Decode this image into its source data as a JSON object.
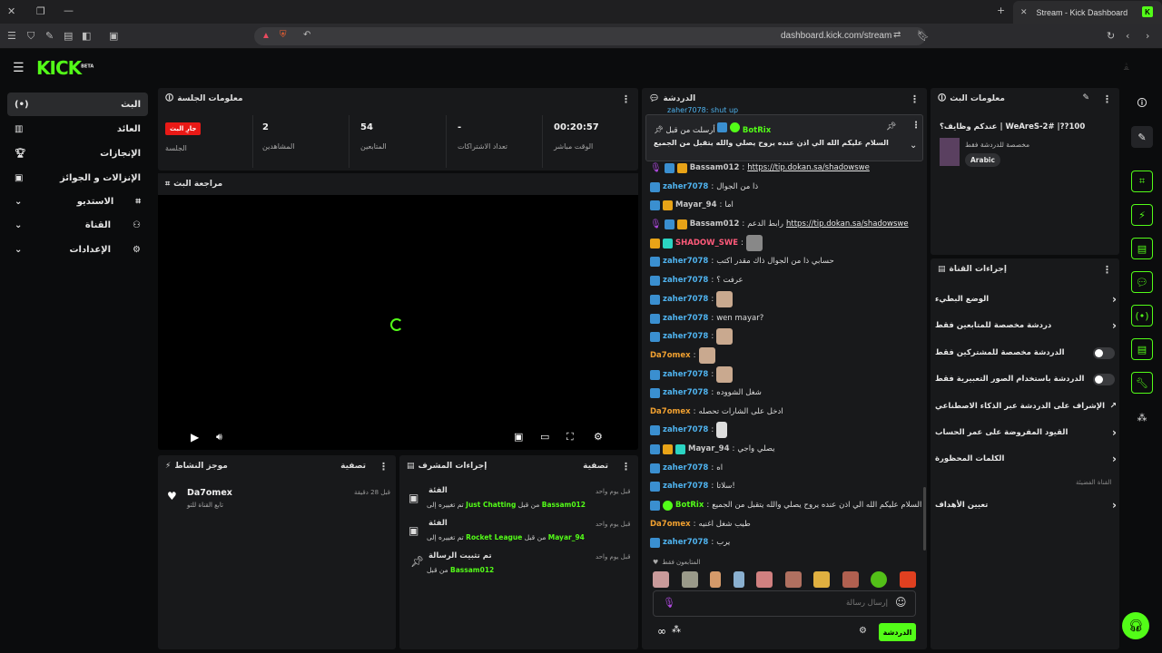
{
  "browser": {
    "tab_title": "Stream - Kick Dashboard",
    "url": "dashboard.kick.com/stream"
  },
  "brand": {
    "logo": "KICK",
    "beta": "BETA",
    "accent": "#53fc18"
  },
  "sidebar": {
    "items": [
      {
        "label": "البث",
        "icon": "broadcast-icon"
      },
      {
        "label": "العائد",
        "icon": "revenue-icon"
      },
      {
        "label": "الإنجازات",
        "icon": "trophy-icon"
      },
      {
        "label": "الإنزالات و الجوائز",
        "icon": "drops-icon"
      },
      {
        "label": "الاستديو",
        "icon": "studio-icon"
      },
      {
        "label": "القناة",
        "icon": "channel-icon"
      },
      {
        "label": "الإعدادات",
        "icon": "gear-icon"
      }
    ]
  },
  "session": {
    "title": "معلومات الجلسة",
    "badge": "جارِ البث",
    "badge_label": "الجلسة",
    "viewers_value": "2",
    "viewers_label": "المشاهدين",
    "followers_value": "54",
    "followers_label": "المتابعين",
    "subs_value": "-",
    "subs_label": "تعداد الاشتراكات",
    "time_value": "00:20:57",
    "time_label": "الوقت مباشر"
  },
  "preview": {
    "title": "مراجعة البث"
  },
  "activity": {
    "title": "موجز النشاط",
    "filter": "تصفية",
    "items": [
      {
        "user": "Da7omex",
        "text": "تابع القناة للتو",
        "time": "قبل 28 دقيقة"
      }
    ]
  },
  "mod_actions": {
    "title": "إجراءات المشرف",
    "filter": "تصفية",
    "items": [
      {
        "title": "الفئة",
        "pre": "تم تغييره إلى",
        "value": "Just Chatting",
        "by": "من قبل",
        "user": "Bassam012",
        "time": "قبل يوم واحد"
      },
      {
        "title": "الفئة",
        "pre": "تم تغييره إلى",
        "value": "Rocket League",
        "by": "من قبل",
        "user": "Mayar_94",
        "time": "قبل يوم واحد"
      },
      {
        "title": "تم تثبيت الرسالة",
        "pre": "",
        "value": "",
        "by": "من قبل",
        "user": "Bassam012",
        "time": "قبل يوم واحد"
      }
    ]
  },
  "chat": {
    "title": "الدردشة",
    "top_partial": "zaher7078: shut up",
    "pinned": {
      "label": "أرسلت من قبل",
      "user": "BotRix",
      "text": "السلام عليكم الله الي اذن عنده يروح يصلي والله يتقبل من الجميع"
    },
    "messages": [
      {
        "user": "Bassam012",
        "color": "gray",
        "text": "",
        "link": "https://tip.dokan.sa/shadowswe"
      },
      {
        "user": "zaher7078",
        "color": "blue",
        "text": "ذا من الجوال"
      },
      {
        "user": "Mayar_94",
        "color": "gray",
        "text": "اما"
      },
      {
        "user": "Bassam012",
        "color": "gray",
        "text": "رابط الدعم",
        "link": "https://tip.dokan.sa/shadowswe"
      },
      {
        "user": "SHADOW_SWE",
        "color": "pink",
        "text": ""
      },
      {
        "user": "zaher7078",
        "color": "blue",
        "text": "حسابي ذا من الجوال ذاك مقدر اكتب"
      },
      {
        "user": "zaher7078",
        "color": "blue",
        "text": "عرفت ؟"
      },
      {
        "user": "zaher7078",
        "color": "blue",
        "text": ""
      },
      {
        "user": "zaher7078",
        "color": "blue",
        "text": "wen mayar?"
      },
      {
        "user": "zaher7078",
        "color": "blue",
        "text": ""
      },
      {
        "user": "Da7omex",
        "color": "orange",
        "text": ""
      },
      {
        "user": "zaher7078",
        "color": "blue",
        "text": ""
      },
      {
        "user": "zaher7078",
        "color": "blue",
        "text": "شغل الشووده"
      },
      {
        "user": "Da7omex",
        "color": "orange",
        "text": "ادخل على الشارات تحصله"
      },
      {
        "user": "zaher7078",
        "color": "blue",
        "text": ""
      },
      {
        "user": "Mayar_94",
        "color": "gray",
        "text": "يصلي واجي"
      },
      {
        "user": "zaher7078",
        "color": "blue",
        "text": "اه"
      },
      {
        "user": "zaher7078",
        "color": "blue",
        "text": "سلاتا!"
      },
      {
        "user": "BotRix",
        "color": "green",
        "text": "السلام عليكم الله الي اذن عنده يروح يصلي والله يتقبل من الجميع"
      },
      {
        "user": "Da7omex",
        "color": "orange",
        "text": "طيب شغل اغنيه"
      },
      {
        "user": "zaher7078",
        "color": "blue",
        "text": "يرب"
      }
    ],
    "followers_only": "المتابعون فقط",
    "input_placeholder": "إرسال رسالة",
    "send_label": "الدردشة"
  },
  "stream_info": {
    "title": "معلومات البث",
    "stream_title": "عندكم وظايف؟ | WeAreS-2# |??100",
    "category": "مخصصة للدردشة فقط",
    "tag": "Arabic"
  },
  "channel_actions": {
    "title": "إجراءات القناة",
    "rows": [
      {
        "label": "الوضع البطيء",
        "kind": "chevron"
      },
      {
        "label": "دردشة مخصصة للمتابعين فقط",
        "kind": "chevron"
      },
      {
        "label": "الدردشة مخصصة للمشتركين فقط",
        "kind": "toggle"
      },
      {
        "label": "الدردشة باستخدام الصور التعبيرية فقط",
        "kind": "toggle"
      },
      {
        "label": "الإشراف على الدردشة عبر الذكاء الاصطناعي",
        "kind": "external"
      },
      {
        "label": "القيود المفروضة على عمر الحساب",
        "kind": "chevron"
      },
      {
        "label": "الكلمات المحظورة",
        "kind": "chevron"
      }
    ],
    "section_label": "القناة الفضيئة",
    "goals_label": "تعيين الأهداف"
  }
}
